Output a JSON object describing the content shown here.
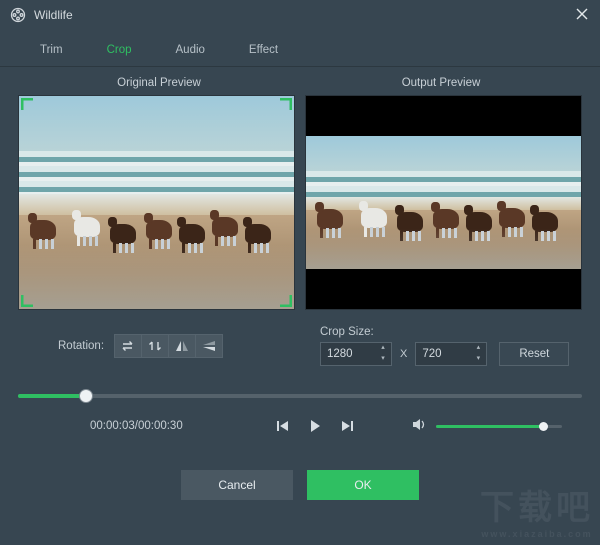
{
  "window": {
    "title": "Wildlife"
  },
  "tabs": {
    "trim": "Trim",
    "crop": "Crop",
    "audio": "Audio",
    "effect": "Effect",
    "active": "crop"
  },
  "preview": {
    "original_label": "Original Preview",
    "output_label": "Output Preview"
  },
  "rotation": {
    "label": "Rotation:"
  },
  "crop_size": {
    "label": "Crop Size:",
    "width": "1280",
    "separator": "X",
    "height": "720",
    "reset_label": "Reset"
  },
  "timeline": {
    "position_percent": 12
  },
  "playback": {
    "time_display": "00:00:03/00:00:30"
  },
  "volume": {
    "percent": 85
  },
  "footer": {
    "cancel": "Cancel",
    "ok": "OK"
  },
  "colors": {
    "accent": "#2fbf62",
    "panel": "#374651"
  }
}
